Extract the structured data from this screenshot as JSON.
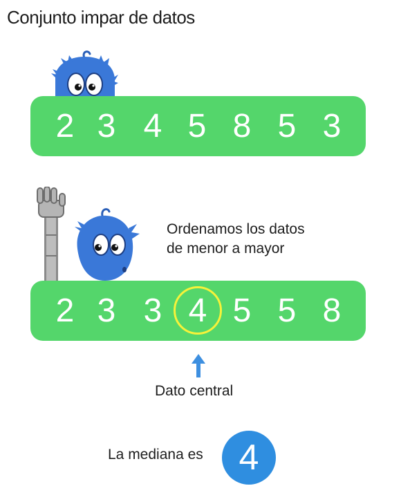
{
  "title": "Conjunto impar de datos",
  "unsorted": {
    "values": [
      "2",
      "3",
      "4",
      "5",
      "8",
      "5",
      "3"
    ]
  },
  "sorted": {
    "caption_line1": "Ordenamos los datos",
    "caption_line2": "de menor a mayor",
    "values": [
      "2",
      "3",
      "3",
      "4",
      "5",
      "5",
      "8"
    ],
    "highlight_index": 3
  },
  "central": {
    "label": "Dato central",
    "arrow_icon": "arrow-up-icon"
  },
  "result": {
    "label": "La mediana es",
    "value": "4"
  },
  "colors": {
    "bar_green": "#54d66b",
    "highlight_yellow": "#f6f23a",
    "arrow_blue": "#3d8fe0",
    "badge_blue": "#2f8ee0",
    "mascot_blue": "#3a78d8"
  },
  "icons": [
    "blue-mascot-peeking-icon",
    "blue-mascot-with-robot-arm-icon"
  ]
}
